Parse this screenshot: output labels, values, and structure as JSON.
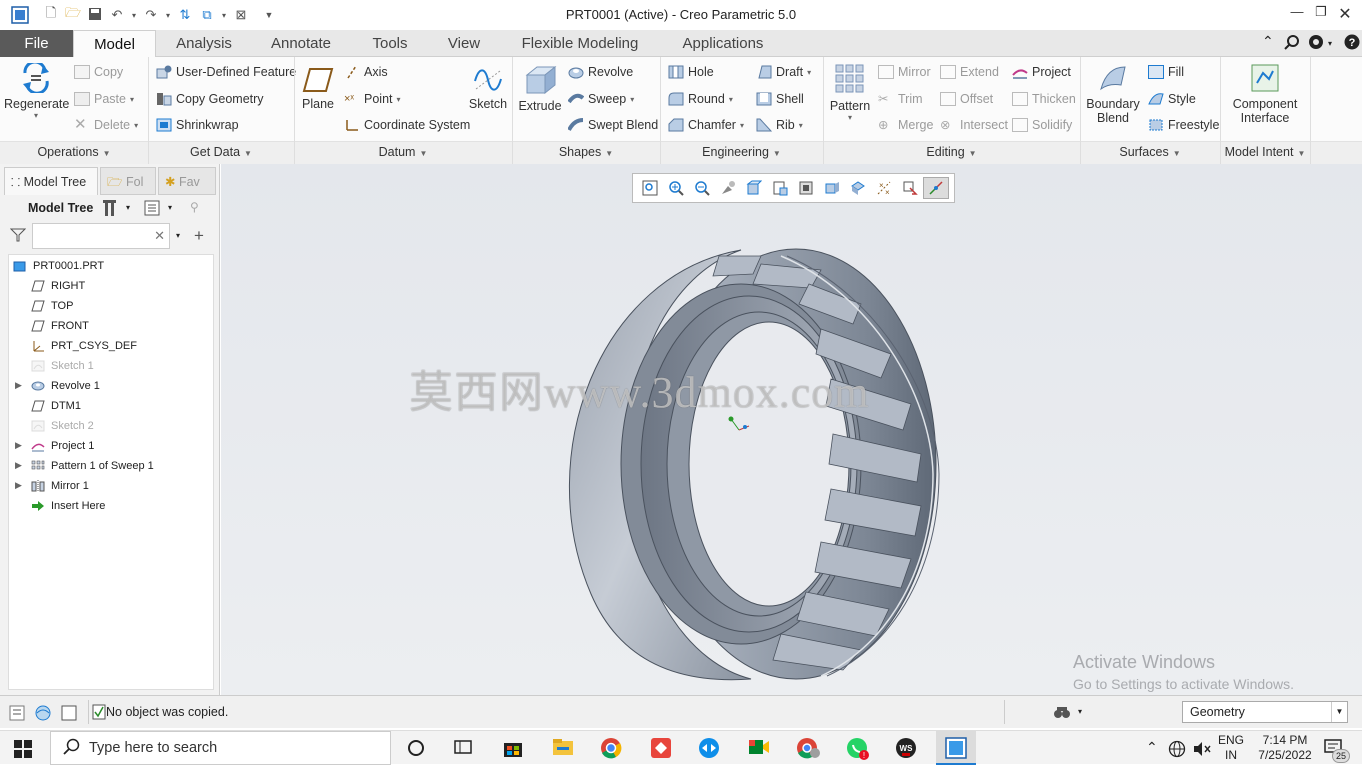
{
  "window": {
    "title": "PRT0001 (Active) - Creo Parametric 5.0"
  },
  "menu": {
    "tabs": [
      "File",
      "Model",
      "Analysis",
      "Annotate",
      "Tools",
      "View",
      "Flexible Modeling",
      "Applications"
    ],
    "active": "Model"
  },
  "ribbon": {
    "operations": {
      "regenerate": "Regenerate",
      "copy": "Copy",
      "paste": "Paste",
      "delete": "Delete",
      "label": "Operations"
    },
    "get_data": {
      "udf": "User-Defined Feature",
      "copy_geometry": "Copy Geometry",
      "shrinkwrap": "Shrinkwrap",
      "label": "Get Data"
    },
    "datum": {
      "plane": "Plane",
      "axis": "Axis",
      "point": "Point",
      "csys": "Coordinate System",
      "sketch": "Sketch",
      "label": "Datum"
    },
    "shapes": {
      "extrude": "Extrude",
      "revolve": "Revolve",
      "sweep": "Sweep",
      "swept_blend": "Swept Blend",
      "label": "Shapes"
    },
    "engineering": {
      "hole": "Hole",
      "round": "Round",
      "chamfer": "Chamfer",
      "draft": "Draft",
      "shell": "Shell",
      "rib": "Rib",
      "label": "Engineering"
    },
    "editing": {
      "pattern": "Pattern",
      "mirror": "Mirror",
      "trim": "Trim",
      "merge": "Merge",
      "extend": "Extend",
      "offset": "Offset",
      "intersect": "Intersect",
      "project": "Project",
      "thicken": "Thicken",
      "solidify": "Solidify",
      "label": "Editing"
    },
    "surfaces": {
      "boundary_blend_1": "Boundary",
      "boundary_blend_2": "Blend",
      "fill": "Fill",
      "style": "Style",
      "freestyle": "Freestyle",
      "label": "Surfaces"
    },
    "model_intent": {
      "component_interface_1": "Component",
      "component_interface_2": "Interface",
      "label": "Model Intent"
    }
  },
  "sidebar": {
    "tabs": [
      "Model Tree",
      "Fol",
      "Fav"
    ],
    "header": "Model Tree",
    "tree": [
      {
        "label": "PRT0001.PRT",
        "dim": false,
        "expand": false
      },
      {
        "label": "RIGHT",
        "dim": false,
        "expand": false
      },
      {
        "label": "TOP",
        "dim": false,
        "expand": false
      },
      {
        "label": "FRONT",
        "dim": false,
        "expand": false
      },
      {
        "label": "PRT_CSYS_DEF",
        "dim": false,
        "expand": false
      },
      {
        "label": "Sketch 1",
        "dim": true,
        "expand": false
      },
      {
        "label": "Revolve 1",
        "dim": false,
        "expand": true
      },
      {
        "label": "DTM1",
        "dim": false,
        "expand": false
      },
      {
        "label": "Sketch 2",
        "dim": true,
        "expand": false
      },
      {
        "label": "Project 1",
        "dim": false,
        "expand": true
      },
      {
        "label": "Pattern 1 of Sweep 1",
        "dim": false,
        "expand": true
      },
      {
        "label": "Mirror 1",
        "dim": false,
        "expand": true
      },
      {
        "label": "Insert Here",
        "dim": false,
        "expand": false
      }
    ]
  },
  "canvas": {
    "watermark": "莫西网www.3dmox.com",
    "activate_title": "Activate Windows",
    "activate_sub": "Go to Settings to activate Windows."
  },
  "status": {
    "message": "No object was copied.",
    "filter": "Geometry"
  },
  "taskbar": {
    "search_placeholder": "Type here to search",
    "lang1": "ENG",
    "lang2": "IN",
    "time": "7:14 PM",
    "date": "7/25/2022",
    "notif_count": "25"
  },
  "colors": {
    "file_tab": "#5a5a5a",
    "accent_blue": "#1e7bd0",
    "model_gray": "#8e98a6"
  }
}
